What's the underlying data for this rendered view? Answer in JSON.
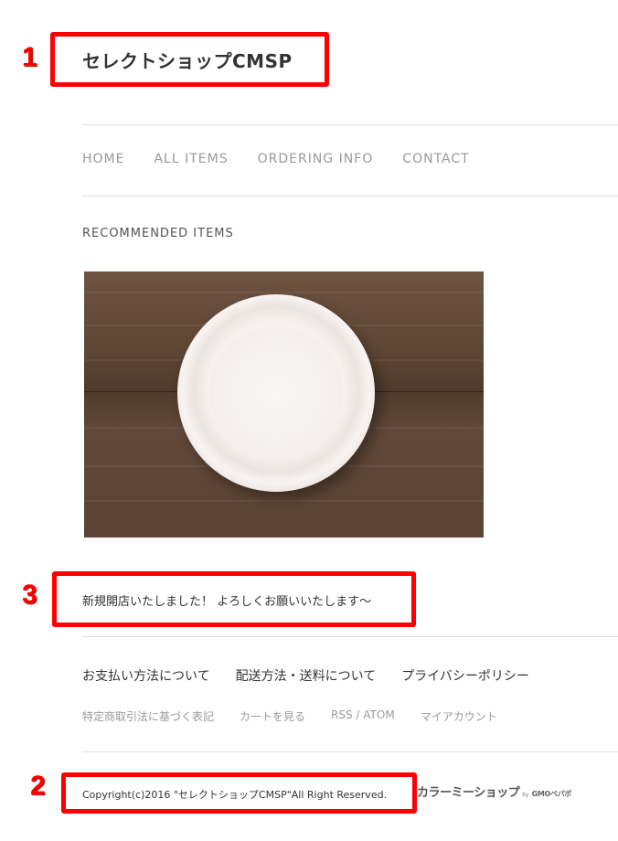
{
  "site": {
    "title": "セレクトショップCMSP"
  },
  "nav": {
    "items": [
      "HOME",
      "ALL ITEMS",
      "ORDERING INFO",
      "CONTACT"
    ]
  },
  "recommended": {
    "heading": "RECOMMENDED ITEMS",
    "image_icon": "plate-image"
  },
  "news": {
    "text": "新規開店いたしました！ よろしくお願いいたします～"
  },
  "footer": {
    "primary_links": [
      "お支払い方法について",
      "配送方法・送料について",
      "プライバシーポリシー"
    ],
    "secondary_links": [
      "特定商取引法に基づく表記",
      "カートを見る",
      "RSS / ATOM",
      "マイアカウント"
    ],
    "copyright": "Copyright(c)2016 \"セレクトショップCMSP\"All Right Reserved.",
    "logo": {
      "main": "カラーミーショップ",
      "by": "by",
      "gmo": "GMOペパボ"
    }
  },
  "annotations": {
    "markers": [
      "1",
      "2",
      "3"
    ],
    "color": "#ff0000"
  }
}
